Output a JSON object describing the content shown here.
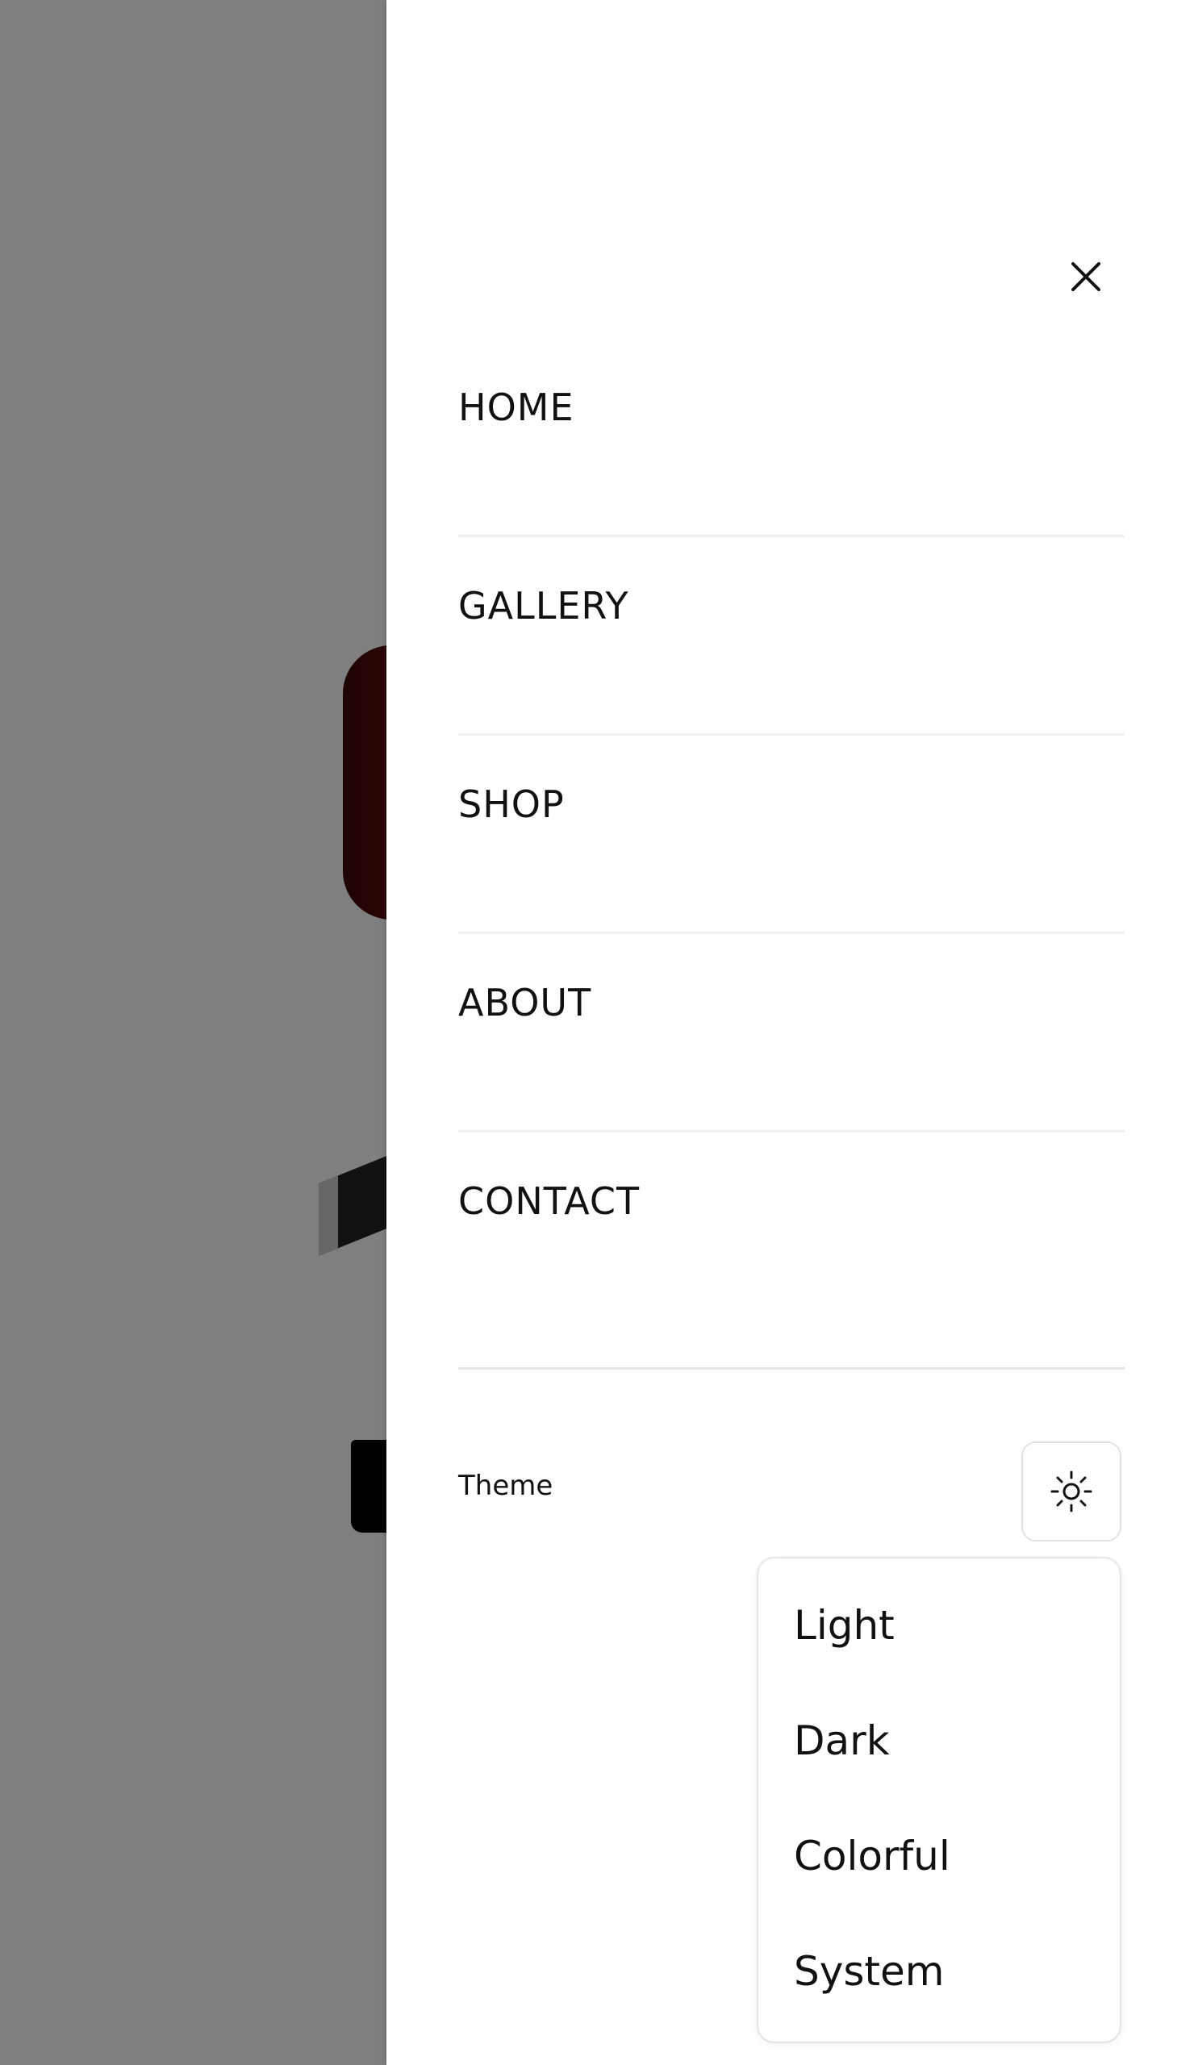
{
  "nav": {
    "items": [
      {
        "label": "HOME"
      },
      {
        "label": "GALLERY"
      },
      {
        "label": "SHOP"
      },
      {
        "label": "ABOUT"
      },
      {
        "label": "CONTACT"
      }
    ]
  },
  "theme": {
    "label": "Theme",
    "current_icon": "sun-icon",
    "options": [
      {
        "label": "Light"
      },
      {
        "label": "Dark"
      },
      {
        "label": "Colorful"
      },
      {
        "label": "System"
      }
    ]
  },
  "icons": {
    "close": "close-icon"
  },
  "colors": {
    "overlay": "#808080",
    "drawer": "#ffffff",
    "text": "#111111"
  }
}
